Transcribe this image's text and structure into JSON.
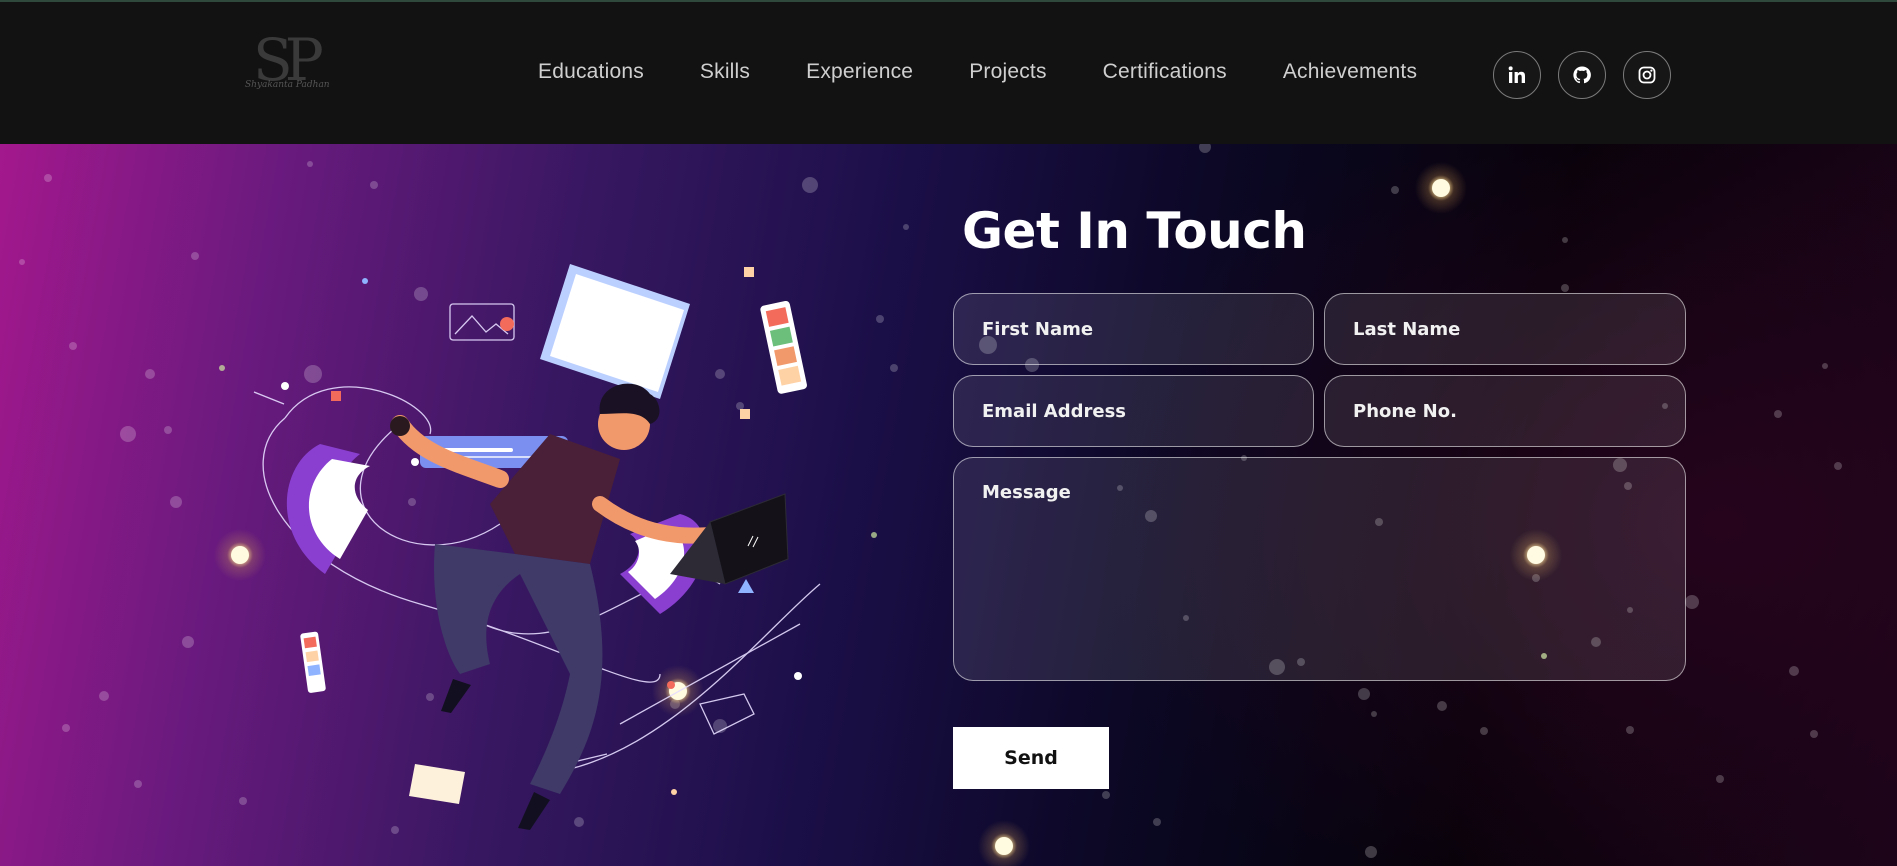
{
  "header": {
    "logo": {
      "monogram": "SP",
      "signature": "Shyakanta Padhan"
    },
    "nav": [
      "Educations",
      "Skills",
      "Experience",
      "Projects",
      "Certifications",
      "Achievements"
    ],
    "socials": [
      "linkedin-icon",
      "github-icon",
      "instagram-icon"
    ]
  },
  "contact": {
    "title": "Get In Touch",
    "first_name_placeholder": "First Name",
    "last_name_placeholder": "Last Name",
    "email_placeholder": "Email Address",
    "phone_placeholder": "Phone No.",
    "message_placeholder": "Message",
    "send_label": "Send"
  },
  "colors": {
    "header_bg": "#121212",
    "gradient_start": "#a3188d",
    "gradient_mid": "#1b0f48",
    "gradient_end": "#030207",
    "button_bg": "#ffffff"
  }
}
